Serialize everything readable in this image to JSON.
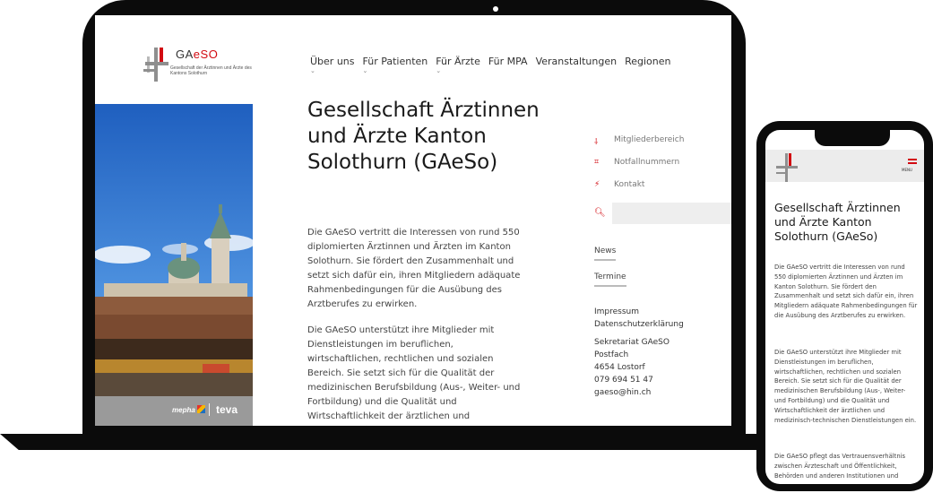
{
  "site": {
    "logo_name_1": "GA",
    "logo_name_2": "eSO",
    "logo_subtitle": "Gesellschaft der Ärztinnen und Ärzte des Kantons Solothurn"
  },
  "nav": {
    "items": [
      {
        "label": "Über uns",
        "caret": "⌄"
      },
      {
        "label": "Für Patienten",
        "caret": "⌄"
      },
      {
        "label": "Für Ärzte",
        "caret": "⌄"
      },
      {
        "label": "Für MPA",
        "caret": ""
      },
      {
        "label": "Veranstaltungen",
        "caret": ""
      },
      {
        "label": "Regionen",
        "caret": ""
      }
    ]
  },
  "main": {
    "title": "Gesellschaft Ärztinnen und Ärzte Kanton Solothurn (GAeSo)",
    "paragraph_1": "Die GAeSO vertritt die Interessen von rund 550 diplomierten Ärztinnen und Ärzten im Kanton Solothurn. Sie fördert den Zusammenhalt und setzt sich dafür ein, ihren Mitgliedern adäquate Rahmenbedingungen für die Ausübung des Arztberufes zu erwirken.",
    "paragraph_2": "Die GAeSO unterstützt ihre Mitglieder mit Dienstleistungen im beruflichen, wirtschaftlichen, rechtlichen und sozialen Bereich. Sie setzt sich für die Qualität der medizinischen Berufsbildung (Aus-, Weiter- und Fortbildung) und die Qualität und Wirtschaftlichkeit der ärztlichen und medizinisch-technischen Dienstleistungen ein."
  },
  "hero": {
    "sponsor_1": "mepha",
    "sponsor_2": "teva"
  },
  "sidebar": {
    "links": [
      {
        "label": "Mitgliederbereich",
        "icon": "member-icon"
      },
      {
        "label": "Notfallnummern",
        "icon": "emergency-icon"
      },
      {
        "label": "Kontakt",
        "icon": "contact-icon"
      }
    ],
    "search_icon": "search-icon",
    "tabs": [
      "News",
      "Termine"
    ],
    "legal": [
      "Impressum",
      "Datenschutzerklärung"
    ],
    "address": [
      "Sekretariat GAeSO",
      "Postfach",
      "4654 Lostorf",
      "079 694 51 47",
      "gaeso@hin.ch"
    ]
  },
  "mobile": {
    "menu_label": "MENU",
    "title": "Gesellschaft Ärztinnen und Ärzte Kanton Solothurn (GAeSo)",
    "paragraph_1": "Die GAeSO vertritt die Interessen von rund 550 diplomierten Ärztinnen und Ärzten im Kanton Solothurn. Sie fördert den Zusammenhalt und setzt sich dafür ein, ihren Mitgliedern adäquate Rahmenbedingungen für die Ausübung des Arztberufes zu erwirken.",
    "paragraph_2": "Die GAeSO unterstützt ihre Mitglieder mit Dienstleistungen im beruflichen, wirtschaftlichen, rechtlichen und sozialen Bereich. Sie setzt sich für die Qualität der medizinischen Berufsbildung (Aus-, Weiter- und Fortbildung) und die Qualität und Wirtschaftlichkeit der ärztlichen und medizinisch-technischen Dienstleistungen ein.",
    "paragraph_3": "Die GAeSO pflegt das Vertrauensverhältnis zwischen Ärzteschaft und Öffentlichkeit, Behörden und anderen Institutionen und"
  },
  "colors": {
    "brand_red": "#d20a11",
    "device_black": "#0b0b0b"
  }
}
